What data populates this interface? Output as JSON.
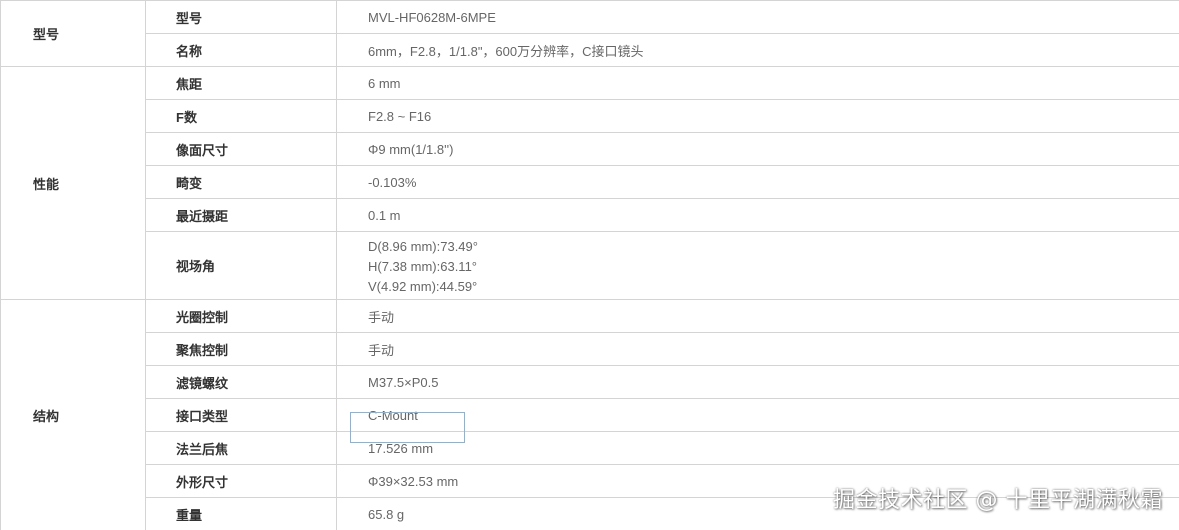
{
  "groups": [
    {
      "label": "型号",
      "rows": [
        {
          "param": "型号",
          "value": "MVL-HF0628M-6MPE"
        },
        {
          "param": "名称",
          "value": "6mm，F2.8，1/1.8\"，600万分辨率，C接口镜头"
        }
      ]
    },
    {
      "label": "性能",
      "rows": [
        {
          "param": "焦距",
          "value": "6 mm"
        },
        {
          "param": "F数",
          "value": "F2.8 ~ F16"
        },
        {
          "param": "像面尺寸",
          "value": "Φ9 mm(1/1.8'')"
        },
        {
          "param": "畸变",
          "value": "-0.103%"
        },
        {
          "param": "最近摄距",
          "value": "0.1 m"
        },
        {
          "param": "视场角",
          "lines": [
            "D(8.96 mm):73.49°",
            "H(7.38 mm):63.11°",
            "V(4.92 mm):44.59°"
          ]
        }
      ]
    },
    {
      "label": "结构",
      "rows": [
        {
          "param": "光圈控制",
          "value": "手动"
        },
        {
          "param": "聚焦控制",
          "value": "手动"
        },
        {
          "param": "滤镜螺纹",
          "value": "M37.5×P0.5"
        },
        {
          "param": "接口类型",
          "value": "C-Mount"
        },
        {
          "param": "法兰后焦",
          "value": "17.526 mm"
        },
        {
          "param": "外形尺寸",
          "value": "Φ39×32.53 mm"
        },
        {
          "param": "重量",
          "value": "65.8 g"
        }
      ]
    }
  ],
  "watermark": "掘金技术社区 @ 十里平湖满秋霜"
}
